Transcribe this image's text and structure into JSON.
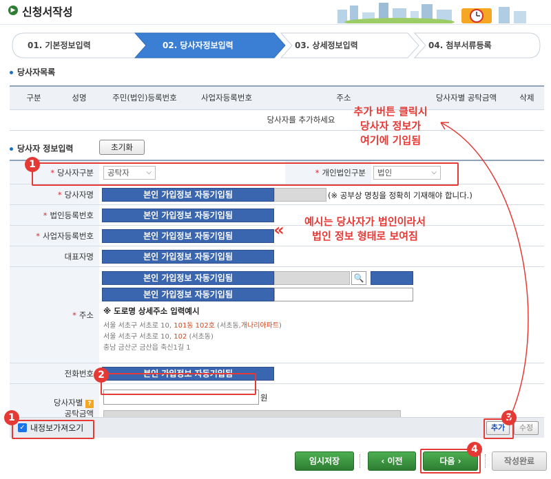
{
  "page": {
    "title": "신청서작성"
  },
  "steps": [
    {
      "label": "01. 기본정보입력"
    },
    {
      "label": "02. 당사자정보입력"
    },
    {
      "label": "03. 상세정보입력"
    },
    {
      "label": "04. 첨부서류등록"
    }
  ],
  "active_step_index": 1,
  "party_list": {
    "section_title": "당사자목록",
    "columns": [
      "구분",
      "성명",
      "주민(법인)등록번호",
      "사업자등록번호",
      "주소",
      "당사자별 공탁금액",
      "삭제"
    ],
    "empty_message": "당사자를 추가하세요"
  },
  "party_form": {
    "section_title": "당사자 정보입력",
    "reset_label": "초기화",
    "fields": {
      "party_type": {
        "label": "당사자구분",
        "value": "공탁자"
      },
      "person_type": {
        "label": "개인법인구분",
        "value": "법인"
      },
      "name": {
        "label": "당사자명",
        "note": "(※ 공부상 명칭을 정확히 기재해야 합니다.)"
      },
      "corp_reg_no": {
        "label": "법인등록번호"
      },
      "biz_reg_no": {
        "label": "사업자등록번호"
      },
      "ceo_name": {
        "label": "대표자명"
      },
      "address": {
        "label": "주소",
        "example_title": "※ 도로명 상세주소 입력예시",
        "examples": [
          {
            "pre": "서울 서초구 서초로 10, ",
            "hl1": "101동 102호",
            "mid": " (서초동,",
            "hl2": "개나리아파트",
            "post": ")"
          },
          {
            "pre": "서울 서초구 서초로 10, ",
            "hl1": "102",
            "mid": " (서초동)",
            "hl2": "",
            "post": ""
          },
          {
            "pre": "충남 금산군 금산읍 축신1길 1",
            "hl1": "",
            "mid": "",
            "hl2": "",
            "post": ""
          }
        ]
      },
      "phone": {
        "label": "전화번호"
      },
      "deposit_amount": {
        "label_line1": "당사자별",
        "label_line2": "공탁금액",
        "unit": "원",
        "help_icon": "?"
      }
    },
    "auto_fill_text": "본인 가입정보 자동기입됨"
  },
  "bottom": {
    "checkbox_label": "내정보가져오기",
    "checkbox_checked": true,
    "add_label": "추가",
    "edit_label": "수정"
  },
  "actions": {
    "temp_save": "임시저장",
    "prev": "‹ 이전",
    "next": "다음 ›",
    "complete": "작성완료"
  },
  "annotations": {
    "top_note": [
      "추가 버튼 클릭시",
      "당사자 정보가",
      "여기에 기입됨"
    ],
    "side_note": [
      "예시는 당사자가 법인이라서",
      "법인 정보 형태로 보여짐"
    ],
    "chevrons": "«",
    "badges": [
      "1",
      "2",
      "1",
      "3",
      "4"
    ]
  },
  "colors": {
    "accent_red": "#e53935",
    "auto_fill_blue": "#3a66b0",
    "active_step_blue": "#3b7fd4",
    "green_button": "#2e7d32"
  },
  "icons": {
    "title_icon": "arrow-circle-icon",
    "search_icon": "magnifier-icon",
    "help_icon": "question-icon",
    "checkbox_icon": "check-icon"
  }
}
